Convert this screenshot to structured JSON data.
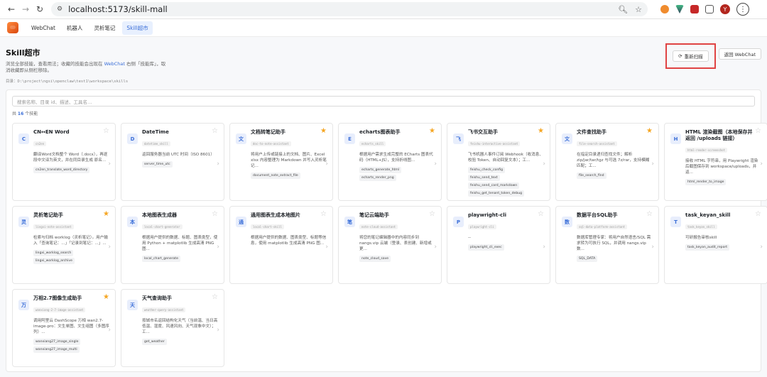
{
  "browser": {
    "url": "localhost:5173/skill-mall",
    "avatar_letter": "Y"
  },
  "nav": {
    "tabs": [
      {
        "label": "WebChat"
      },
      {
        "label": "机器人"
      },
      {
        "label": "灵析笔记"
      },
      {
        "label": "Skill超市"
      }
    ],
    "active_index": 3
  },
  "page": {
    "title": "Skill超市",
    "desc_part1": "浏览全部技能，查看用法；收藏的技能会出现在 ",
    "desc_link": "WebChat",
    "desc_part2": " 右侧「技能库」，取消收藏即从侧栏移除。",
    "dir_label": "目录：D:\\project\\ngsi\\openclaw\\test1\\workspace\\skills",
    "rescan_label": "重新扫描",
    "back_label": "返回 WebChat",
    "search_placeholder": "搜索名称、目录 id、描述、工具名…",
    "count_prefix": "共 ",
    "count": "16",
    "count_suffix": " 个技能"
  },
  "skills": [
    {
      "icon": "C",
      "title": "CN↔EN Word",
      "id": "cn2en",
      "desc": "翻译Word文档整个 Word（.docx），再逐段中文译为英文，并在同目录生成 原名...",
      "tags": [
        "cn2en_translate_word_directory"
      ],
      "starred": false
    },
    {
      "icon": "D",
      "title": "DateTime",
      "id": "datetime_skill",
      "desc": "返回服务器当前 UTC 时间（ISO 8601）",
      "tags": [
        "server_time_utc"
      ],
      "starred": false
    },
    {
      "icon": "文",
      "title": "文档转笔记助手",
      "id": "doc-to-note-assistant",
      "desc": "将用户上传或链接上的文档、图片、Excel xlsx 内容整理为 Markdown 并写入灵析笔记...",
      "tags": [
        "document_note_extract_file"
      ],
      "starred": true
    },
    {
      "icon": "E",
      "title": "echarts图表助手",
      "id": "echarts_skill",
      "desc": "根据用户需求生成完整的 ECharts 图表代码（HTML+JS），支持折线图...",
      "tags": [
        "echarts_generate_html",
        "echarts_render_png"
      ],
      "starred": true
    },
    {
      "icon": "飞",
      "title": "飞书交互助手",
      "id": "feishu-interactive-assistant",
      "desc": "飞书机器人事件订阅 Webhook（收消息、校验 Token、自动回复文本）；工...",
      "tags": [
        "feishu_check_config",
        "feishu_send_text",
        "feishu_send_card_markdown",
        "feishu_get_tenant_token_debug"
      ],
      "starred": true
    },
    {
      "icon": "文",
      "title": "文件查找助手",
      "id": "file-search-assistant",
      "desc": "在指定目录递归查找文件；解析 zip/jar/tar/tgz 与可选 7z/rar，支持模糊匹配；工...",
      "tags": [
        "file_search_find"
      ],
      "starred": true
    },
    {
      "icon": "H",
      "title": "HTML 渲染截图（本地保存并返回 /uploads 链接）",
      "id": "html-render-screenshot",
      "desc": "接收 HTML 字符串，用 Playwright 渲染后截图保存到 workspace/uploads，并返...",
      "tags": [
        "html_render_to_image"
      ],
      "starred": false
    },
    {
      "icon": "灵",
      "title": "灵析笔记助手",
      "id": "lingxi-note-assistant",
      "desc": "检索与归档 worklog（灵析笔记）。用户输入「查询笔记：...」「记录到笔记：...」...",
      "tags": [
        "lingxi_worklog_search",
        "lingxi_worklog_archive"
      ],
      "starred": true
    },
    {
      "icon": "本",
      "title": "本地图表生成器",
      "id": "local-chart-generator",
      "desc": "根据用户提供的数据、标题、图表类型，使用 Python + matplotlib 生成高清 PNG 图...",
      "tags": [
        "local_chart_generate"
      ],
      "starred": false
    },
    {
      "icon": "通",
      "title": "通用图表生成本地图片",
      "id": "local-chart-skill",
      "desc": "根据用户提供的数据、图表类型、标题等信息，使用 matplotlib 生成高清 PNG 图...",
      "tags": [],
      "starred": false
    },
    {
      "icon": "笔",
      "title": "笔记云端助手",
      "id": "note-cloud-assistant",
      "desc": "将您的笔记编辑器中的内容同步到 nangs.vip 云端（登录、表创建、新增或更...",
      "tags": [
        "note_cloud_save"
      ],
      "starred": false
    },
    {
      "icon": "P",
      "title": "playwright-cli",
      "id": "playwright-cli",
      "desc": "--",
      "tags": [
        "playwright_cli_exec"
      ],
      "starred": false
    },
    {
      "icon": "数",
      "title": "数据平台SQL助手",
      "id": "sql-data-platform-assistant",
      "desc": "数据库管理专家：将用户自然语言/SQL 需求转为可执行 SQL，并调用 nangs.vip 数...",
      "tags": [
        "SQL_DATA"
      ],
      "starred": false
    },
    {
      "icon": "T",
      "title": "task_keyan_skill",
      "id": "task_keyan_skill",
      "desc": "可研报告审核skill",
      "tags": [
        "task_keyan_audit_report"
      ],
      "starred": false
    },
    {
      "icon": "万",
      "title": "万相2.7图像生成助手",
      "id": "wanxiang-2-7-image-assistant",
      "desc": "调用阿里云 DashScope 万相 wan2.7-image-pro：文生单图、文生组图（多图序列）...",
      "tags": [
        "wanxiang27_image_single",
        "wanxiang27_image_multi"
      ],
      "starred": true
    },
    {
      "icon": "天",
      "title": "天气查询助手",
      "id": "weather-query-assistant",
      "desc": "按城市名返回结构化天气（当前温、当日高低温、湿度、风速风向、天气现象中文）；工...",
      "tags": [
        "get_weather"
      ],
      "starred": false
    }
  ],
  "colors": {
    "accent": "#3b6fd8",
    "star": "#f5a623",
    "highlight": "#e04343"
  },
  "icons": {
    "star": "star-icon",
    "chevron": "chevron-right-icon",
    "refresh": "refresh-icon"
  }
}
